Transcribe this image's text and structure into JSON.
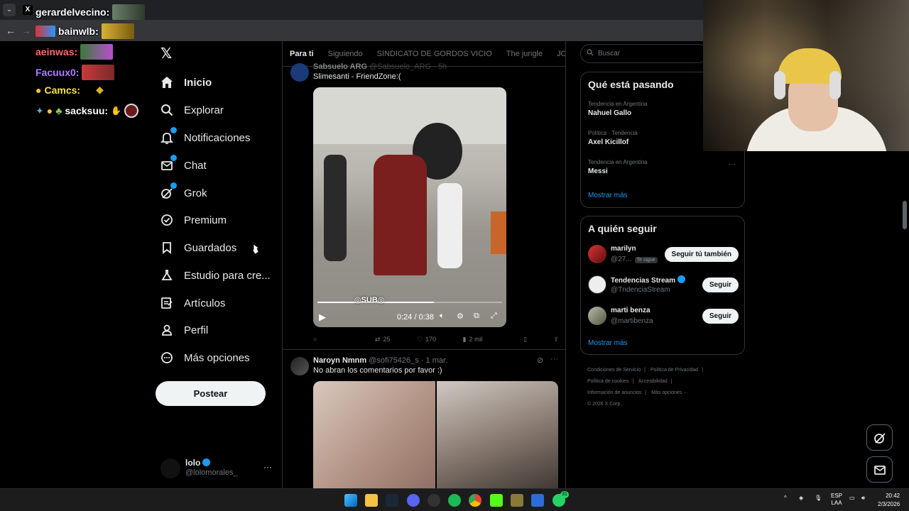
{
  "browser": {
    "tabs": [
      {
        "label": "gerardelvecino:",
        "favicon": "X"
      }
    ],
    "overlay_line": "bainwlb:"
  },
  "chat": [
    {
      "user": "gerardelvecino:",
      "color": "#ffffff"
    },
    {
      "user": "bainwlb:",
      "color": "#ffffff"
    },
    {
      "user": "aeinwas:",
      "color": "#ff6b6b"
    },
    {
      "user": "Facuux0:",
      "color": "#b07cff"
    },
    {
      "user": "Camcs:",
      "color": "#f7e24b"
    },
    {
      "user": "sacksuu:",
      "color": "#ffffff"
    }
  ],
  "sidebar": {
    "items": [
      {
        "label": "Inicio",
        "icon": "home-icon",
        "active": true
      },
      {
        "label": "Explorar",
        "icon": "search-icon"
      },
      {
        "label": "Notificaciones",
        "icon": "bell-icon",
        "badge": true
      },
      {
        "label": "Chat",
        "icon": "mail-icon",
        "badge": true
      },
      {
        "label": "Grok",
        "icon": "grok-icon",
        "badge": true
      },
      {
        "label": "Premium",
        "icon": "premium-icon"
      },
      {
        "label": "Guardados",
        "icon": "bookmark-icon"
      },
      {
        "label": "Estudio para cre...",
        "icon": "flask-icon"
      },
      {
        "label": "Artículos",
        "icon": "article-icon"
      },
      {
        "label": "Perfil",
        "icon": "person-icon"
      },
      {
        "label": "Más opciones",
        "icon": "more-circle-icon"
      }
    ],
    "post_label": "Postear",
    "profile": {
      "name": "lolo",
      "handle": "@lolomorales_",
      "more": "···"
    }
  },
  "timeline": {
    "tabs": [
      "Para ti",
      "Siguiendo",
      "SINDICATO DE GORDOS VICIO",
      "The jungle",
      "JOSEO"
    ],
    "active_tab": 0,
    "tweet1": {
      "name": "Sabsuelo ARG",
      "handle": "@Sabsuelo_ARG · 5h",
      "text": "Slimesanti - FriendZone:(",
      "video": {
        "time": "0:24 / 0:38",
        "progress": 0.63
      },
      "actions": {
        "reply": "",
        "retweet": "25",
        "like": "170",
        "views": "2 mil"
      }
    },
    "tweet2": {
      "name": "Naroyn Nmnm",
      "handle": "@sofi75426_s · 1 mar.",
      "text": "No abran los comentarios por favor :)"
    }
  },
  "right": {
    "search_placeholder": "Buscar",
    "trends_title": "Qué está pasando",
    "trends": [
      {
        "context": "Tendencia en Argentina",
        "name": "Nahuel Gallo"
      },
      {
        "context": "Política · Tendencia",
        "name": "Axel Kicillof"
      },
      {
        "context": "Tendencia en Argentina",
        "name": "Messi"
      }
    ],
    "trends_more": "···",
    "show_more": "Mostrar más",
    "follow_title": "A quién seguir",
    "follow": [
      {
        "name": "marilyn",
        "handle": "@27...",
        "tag": "Te sigue",
        "button": "Seguir tú también"
      },
      {
        "name": "Tendencias Stream",
        "handle": "@TndenciaStream",
        "button": "Seguir",
        "verified": true
      },
      {
        "name": "marti benza",
        "handle": "@martibenza",
        "button": "Seguir"
      }
    ],
    "follow_more": "Mostrar más",
    "footer": [
      "Condiciones de Servicio",
      "|",
      "Política de Privacidad",
      "|",
      "Política de cookies",
      "|",
      "Accesibilidad",
      "|",
      "Información de anuncios",
      "|",
      "Más opciones ···",
      "© 2026 X Corp."
    ]
  },
  "taskbar": {
    "lang": "ESP",
    "lang2": "LAA",
    "time": "20:42",
    "date": "2/3/2026",
    "whatsapp_badge": "31"
  }
}
